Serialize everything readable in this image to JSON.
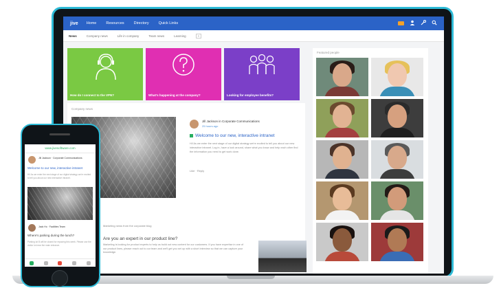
{
  "nav": {
    "logo": "jive",
    "items": [
      "Home",
      "Resources",
      "Directory",
      "Quick Links"
    ]
  },
  "subnav": {
    "items": [
      "News",
      "Company news",
      "Life in company",
      "Team news",
      "Learning"
    ],
    "plus": "+"
  },
  "tiles": [
    {
      "caption": "How do I connect to the VPN?",
      "color": "#7ac943",
      "icon": "headset-person-icon"
    },
    {
      "caption": "What's happening at the company?",
      "color": "#e02fb2",
      "icon": "question-mark-icon"
    },
    {
      "caption": "Looking for employee benefits?",
      "color": "#7b3fc8",
      "icon": "people-group-icon"
    }
  ],
  "news": {
    "label": "Company news",
    "author": "Jill Jackson in Corporate Communications",
    "time": "25 hours ago",
    "title": "Welcome to our new, interactive intranet",
    "body": "Hi! As we enter the next stage of our digital strategy we're excited to tell you about our new interactive intranet. Log in, have a look around, share what you know and help each other find the information you need to get work done.",
    "actions": "Like  ·  Reply",
    "post2_meta": "Marketing news from the corporate blog",
    "post2_title": "Are you an expert in our product line?",
    "post2_body": "Marketing is looking for product experts to help us build out new content for our customers. If you have expertise in one of our product lines, please reach out to our team and we'll get you set up with a short interview so that we can capture your knowledge."
  },
  "people": {
    "label": "Featured people"
  },
  "phone": {
    "app_title": "www.jivesoftware.com",
    "author": "Jill Jackson · Corporate Communications",
    "title": "Welcome to our new, interactive intranet",
    "body": "Hi! As we enter the next stage of our digital strategy we're excited to tell you about our new interactive intranet.",
    "author2": "Jack Ho · Facilities Team",
    "title2": "Where's parking during the lunch?",
    "body2": "Parking lot B will be closed for repaving this week. Please use the visitor lot near the main entrance."
  },
  "colors": {
    "accent": "#2b63c7",
    "bezel_trim": "#2dbad6",
    "green": "#27ae60"
  }
}
